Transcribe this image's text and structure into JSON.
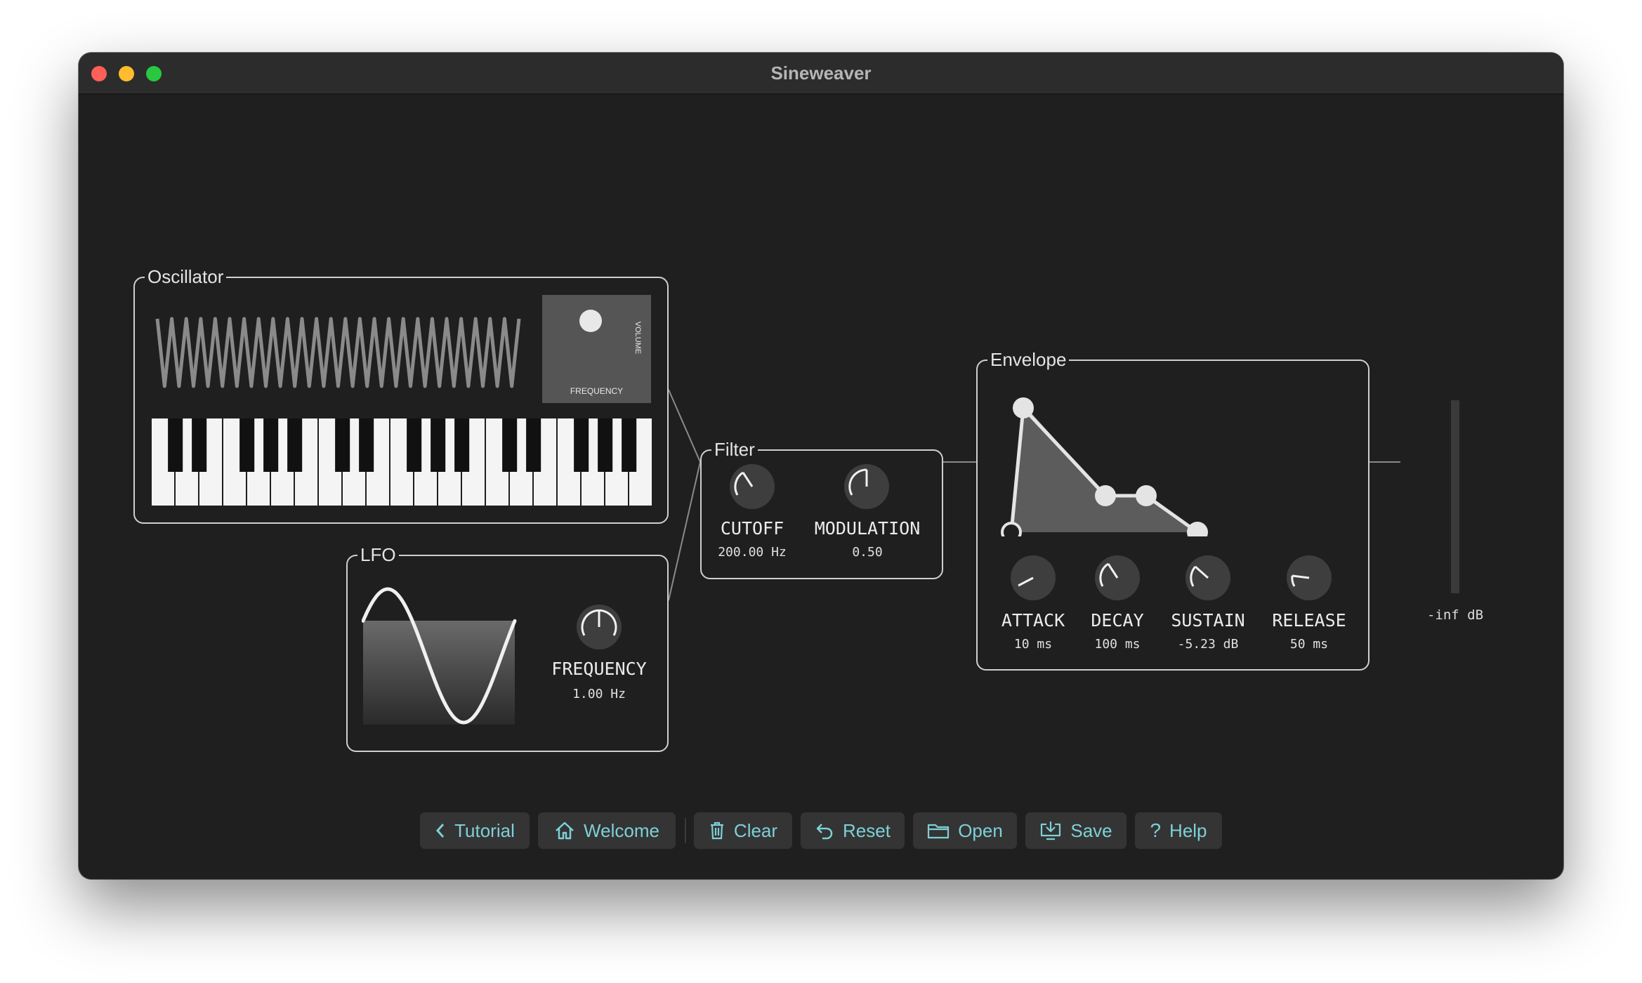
{
  "window": {
    "title": "Sineweaver"
  },
  "oscillator": {
    "title": "Oscillator",
    "pad_y_label": "VOLUME",
    "pad_x_label": "FREQUENCY"
  },
  "lfo": {
    "title": "LFO",
    "knob": {
      "label": "FREQUENCY",
      "value": "1.00 Hz"
    }
  },
  "filter": {
    "title": "Filter",
    "knobs": [
      {
        "label": "CUTOFF",
        "value": "200.00 Hz"
      },
      {
        "label": "MODULATION",
        "value": "0.50"
      }
    ]
  },
  "envelope": {
    "title": "Envelope",
    "knobs": [
      {
        "label": "ATTACK",
        "value": "10 ms"
      },
      {
        "label": "DECAY",
        "value": "100 ms"
      },
      {
        "label": "SUSTAIN",
        "value": "-5.23 dB"
      },
      {
        "label": "RELEASE",
        "value": "50 ms"
      }
    ]
  },
  "output": {
    "level": "-inf dB"
  },
  "toolbar": {
    "tutorial": "Tutorial",
    "welcome": "Welcome",
    "clear": "Clear",
    "reset": "Reset",
    "open": "Open",
    "save": "Save",
    "help": "Help"
  },
  "colors": {
    "accent": "#7ed0d8",
    "background": "#1f1f1f",
    "panel": "#343434"
  },
  "icons": [
    "chevron-left-icon",
    "home-icon",
    "trash-icon",
    "undo-icon",
    "folder-icon",
    "download-icon",
    "question-icon"
  ]
}
